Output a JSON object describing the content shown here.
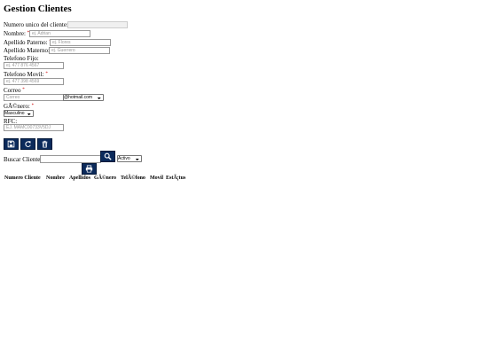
{
  "page": {
    "title": "Gestion Clientes"
  },
  "form": {
    "numero_label": "Numero unico del cliente:",
    "numero_value": "",
    "nombre_label": "Nombre:",
    "nombre_placeholder": "ej. Adrian",
    "paterno_label": "Apellido Paterno:",
    "paterno_placeholder": "ej. Flores",
    "materno_label": "Apellido Materno:",
    "materno_placeholder": "ej. Guerrero",
    "tel_fijo_label": "Telefono Fijo:",
    "tel_fijo_placeholder": "ej. 477 876 4567",
    "tel_movil_label": "Telefono Movil:",
    "tel_movil_placeholder": "ej. 477 398 4569",
    "correo_label": "Correo",
    "correo_placeholder": "Correo",
    "dominio_selected": "@hotmail.com",
    "genero_label": "GÃ©nero:",
    "genero_selected": "Masculino",
    "rfc_label": "RFC:",
    "rfc_placeholder": "EJ. MAMC00733V5DJ",
    "required_mark": "*"
  },
  "actions": {
    "save_icon": "save-icon",
    "refresh_icon": "refresh-icon",
    "delete_icon": "trash-icon"
  },
  "search": {
    "label": "Buscar Cliente",
    "value": "",
    "search_icon": "search-icon",
    "status_selected": "Activo",
    "print_icon": "printer-icon"
  },
  "table": {
    "headers": [
      "Numero Cliente",
      "Nombre",
      "Apellidos",
      "GÃ©nero",
      "TelÃ©fono",
      "Movil",
      "EstÃ¡tus"
    ]
  },
  "colors": {
    "button_bg": "#0b2a5b",
    "required": "#cc0000"
  }
}
